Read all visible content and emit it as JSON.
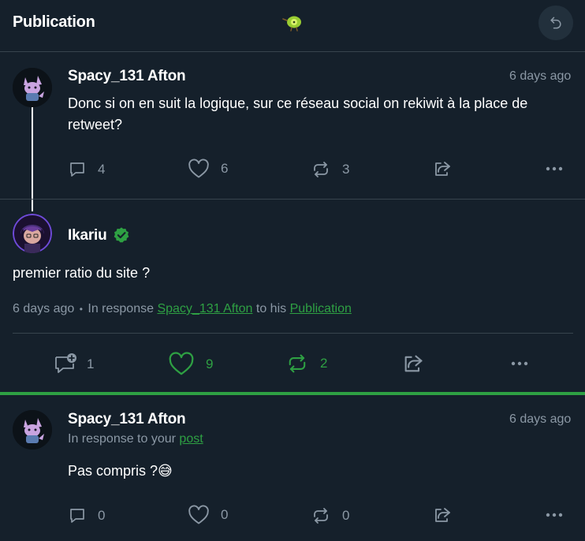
{
  "header": {
    "title": "Publication"
  },
  "colors": {
    "background": "#15202b",
    "accent": "#2ea043",
    "muted": "#8b98a5",
    "border": "#38444d"
  },
  "posts": [
    {
      "author": "Spacy_131 Afton",
      "time": "6 days ago",
      "text": "Donc si on en suit la logique, sur ce réseau social on rekiwit à la place de retweet?",
      "comments": "4",
      "likes": "6",
      "reshares": "3"
    },
    {
      "author": "Ikariu",
      "verified": true,
      "text": "premier ratio du site ?",
      "meta_time": "6 days ago",
      "meta_sep": "•",
      "meta_prefix": "In response",
      "meta_user": "Spacy_131 Afton",
      "meta_mid": "to his",
      "meta_link": "Publication",
      "comments": "1",
      "likes": "9",
      "reshares": "2"
    },
    {
      "author": "Spacy_131 Afton",
      "time": "6 days ago",
      "reply_prefix": "In response to your",
      "reply_link": "post",
      "text": "Pas compris ?",
      "emoji": "😅",
      "comments": "0",
      "likes": "0",
      "reshares": "0"
    }
  ]
}
